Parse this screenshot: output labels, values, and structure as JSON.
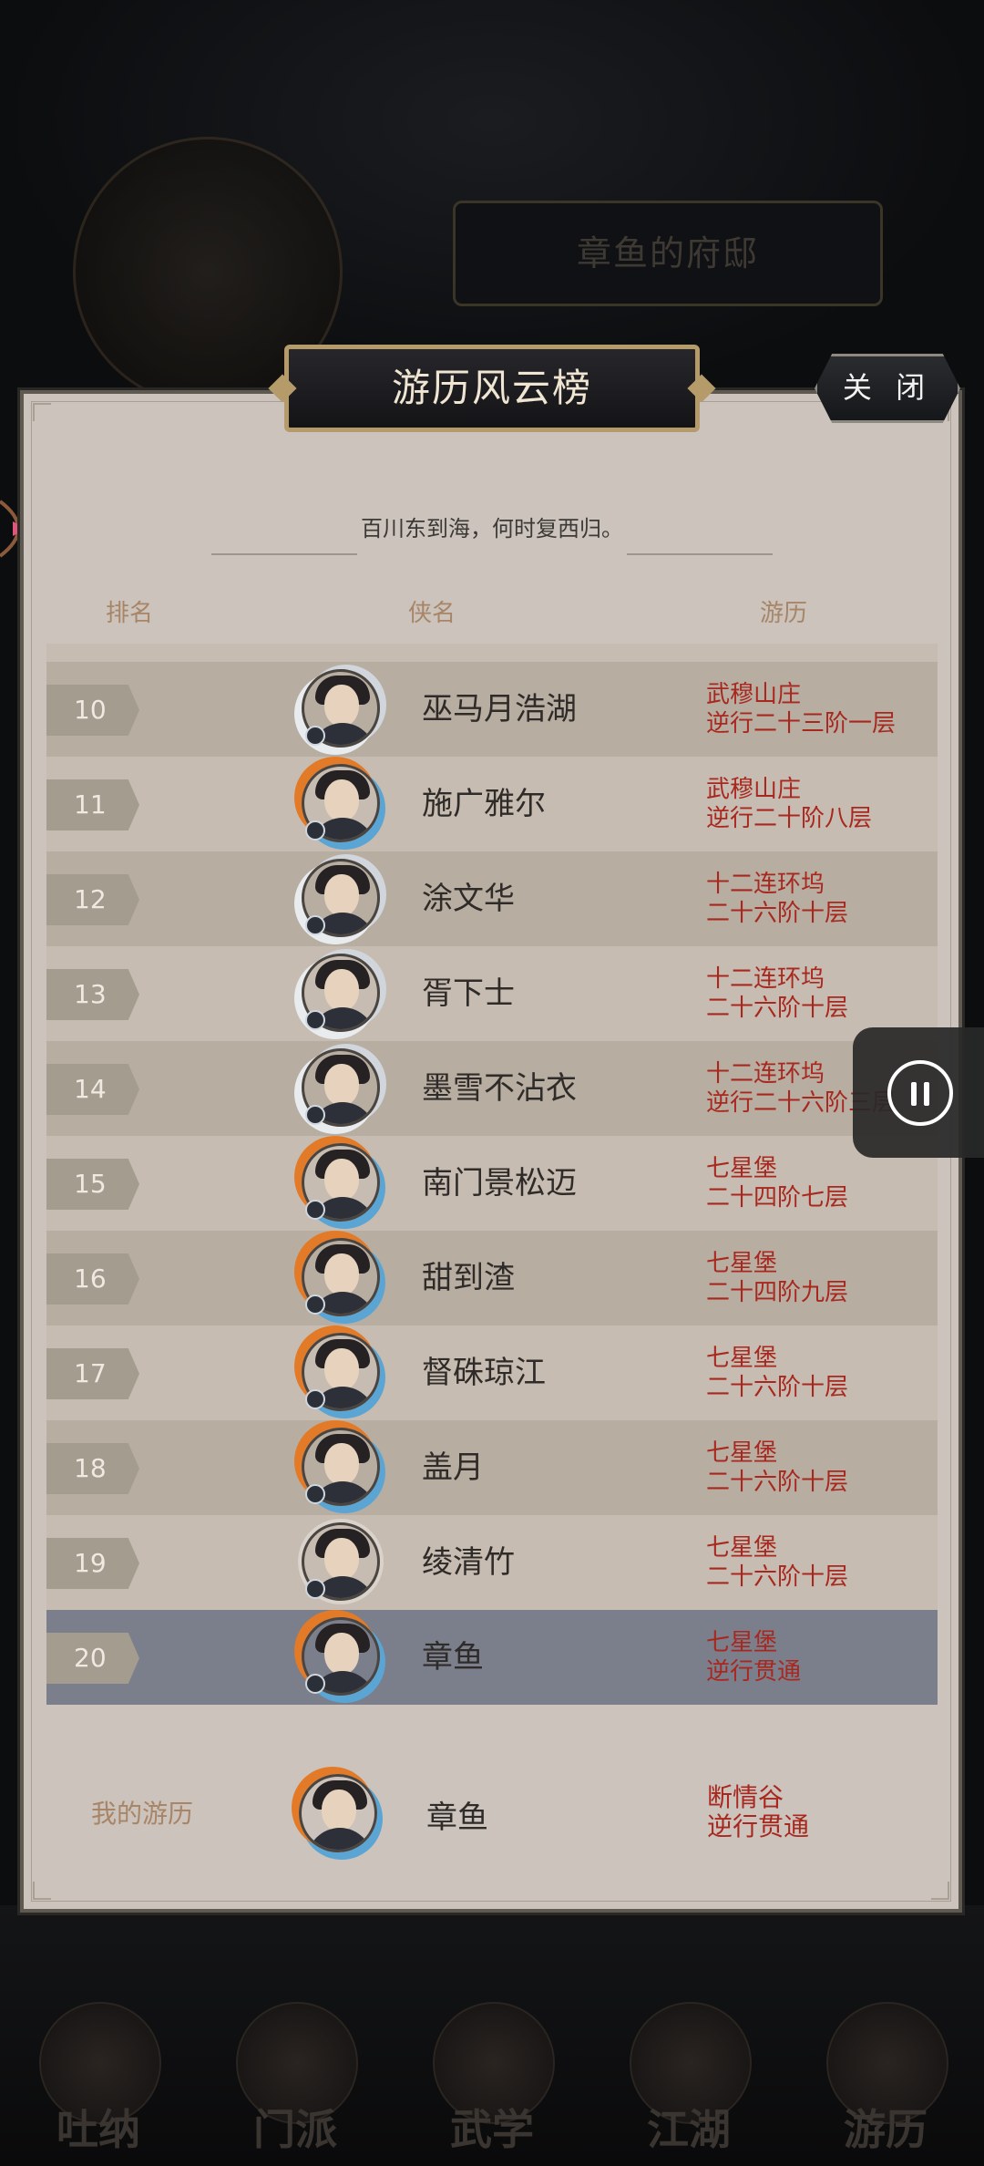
{
  "background": {
    "estate_title": "章鱼的府邸",
    "nav": [
      "吐纳",
      "门派",
      "武学",
      "江湖",
      "游历"
    ]
  },
  "modal": {
    "title": "游历风云榜",
    "close_label": "关 闭",
    "motto": "百川东到海，何时复西归。",
    "columns": {
      "rank": "排名",
      "name": "侠名",
      "exp": "游历"
    }
  },
  "rows": [
    {
      "rank": "10",
      "name": "巫马月浩湖",
      "place": "武穆山庄",
      "stage": "逆行二十三阶一层",
      "frame": "cloud"
    },
    {
      "rank": "11",
      "name": "施广雅尔",
      "place": "武穆山庄",
      "stage": "逆行二十阶八层",
      "frame": "fire"
    },
    {
      "rank": "12",
      "name": "涂文华",
      "place": "十二连环坞",
      "stage": "二十六阶十层",
      "frame": "cloud"
    },
    {
      "rank": "13",
      "name": "胥下士",
      "place": "十二连环坞",
      "stage": "二十六阶十层",
      "frame": "cloud"
    },
    {
      "rank": "14",
      "name": "墨雪不沾衣",
      "place": "十二连环坞",
      "stage": "逆行二十六阶三层",
      "frame": "cloud"
    },
    {
      "rank": "15",
      "name": "南门景松迈",
      "place": "七星堡",
      "stage": "二十四阶七层",
      "frame": "fire"
    },
    {
      "rank": "16",
      "name": "甜到渣",
      "place": "七星堡",
      "stage": "二十四阶九层",
      "frame": "fire"
    },
    {
      "rank": "17",
      "name": "督硃琼江",
      "place": "七星堡",
      "stage": "二十六阶十层",
      "frame": "fire"
    },
    {
      "rank": "18",
      "name": "盖月",
      "place": "七星堡",
      "stage": "二十六阶十层",
      "frame": "fire"
    },
    {
      "rank": "19",
      "name": "绫清竹",
      "place": "七星堡",
      "stage": "二十六阶十层",
      "frame": "plain"
    },
    {
      "rank": "20",
      "name": "章鱼",
      "place": "七星堡",
      "stage": "逆行贯通",
      "frame": "fire",
      "highlight": true
    }
  ],
  "my_record": {
    "label": "我的游历",
    "name": "章鱼",
    "place": "断情谷",
    "stage": "逆行贯通"
  },
  "colors": {
    "panel": "#cbc3bc",
    "row_odd": "#b8ada1",
    "row_even": "#c7bcb1",
    "row_highlight": "#7b7e8b",
    "exp_text": "#a8281f",
    "header_text": "#a78566"
  }
}
